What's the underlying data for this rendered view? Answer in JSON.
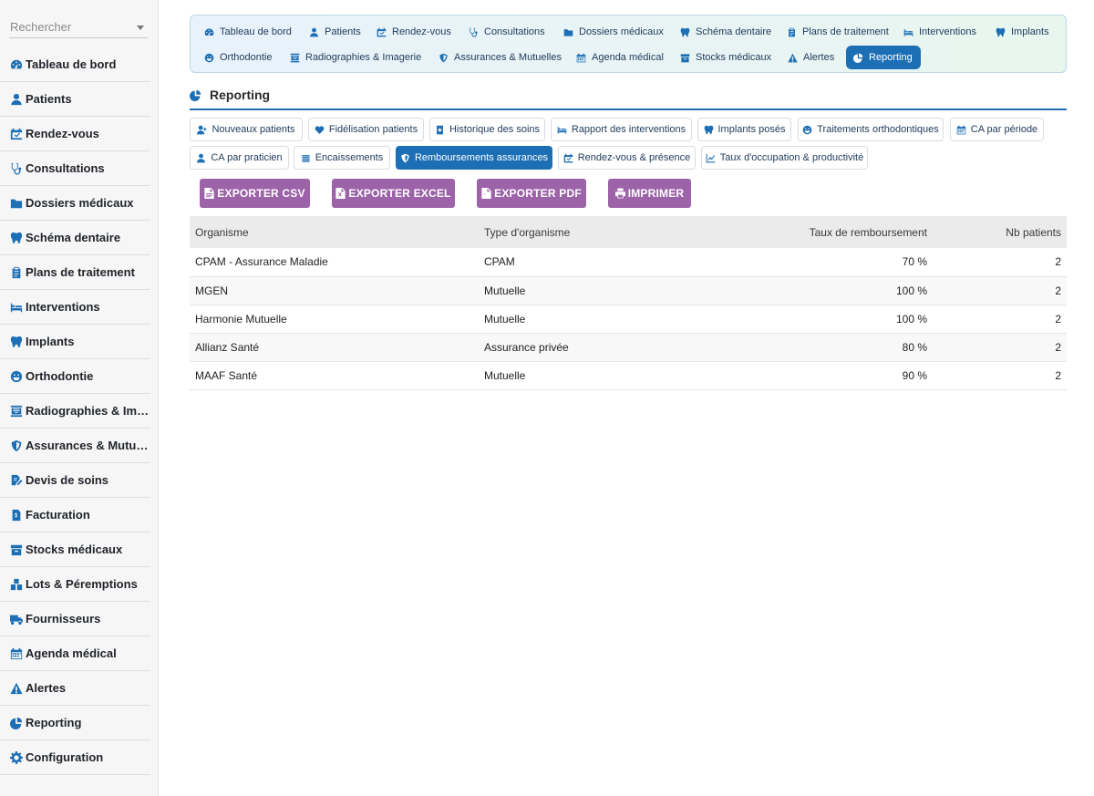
{
  "search": {
    "placeholder": "Rechercher"
  },
  "sidebar": {
    "items": [
      {
        "label": "Tableau de bord",
        "icon": "gauge-icon"
      },
      {
        "label": "Patients",
        "icon": "user-icon"
      },
      {
        "label": "Rendez-vous",
        "icon": "calendar-check-icon"
      },
      {
        "label": "Consultations",
        "icon": "stethoscope-icon"
      },
      {
        "label": "Dossiers médicaux",
        "icon": "folder-icon"
      },
      {
        "label": "Schéma dentaire",
        "icon": "tooth-icon"
      },
      {
        "label": "Plans de traitement",
        "icon": "clipboard-icon"
      },
      {
        "label": "Interventions",
        "icon": "bed-icon"
      },
      {
        "label": "Implants",
        "icon": "tooth-icon"
      },
      {
        "label": "Orthodontie",
        "icon": "smile-icon"
      },
      {
        "label": "Radiographies & Imagerie",
        "icon": "xray-icon"
      },
      {
        "label": "Assurances & Mutuelles",
        "icon": "shield-icon"
      },
      {
        "label": "Devis de soins",
        "icon": "file-signature-icon"
      },
      {
        "label": "Facturation",
        "icon": "invoice-icon"
      },
      {
        "label": "Stocks médicaux",
        "icon": "box-icon"
      },
      {
        "label": "Lots & Péremptions",
        "icon": "boxes-icon"
      },
      {
        "label": "Fournisseurs",
        "icon": "truck-icon"
      },
      {
        "label": "Agenda médical",
        "icon": "calendar-icon"
      },
      {
        "label": "Alertes",
        "icon": "warning-icon"
      },
      {
        "label": "Reporting",
        "icon": "pie-chart-icon"
      },
      {
        "label": "Configuration",
        "icon": "gear-icon"
      }
    ]
  },
  "topnav": {
    "tabs": [
      {
        "label": "Tableau de bord"
      },
      {
        "label": "Patients"
      },
      {
        "label": "Rendez-vous"
      },
      {
        "label": "Consultations"
      },
      {
        "label": "Dossiers médicaux"
      },
      {
        "label": "Schéma dentaire"
      },
      {
        "label": "Plans de traitement"
      },
      {
        "label": "Interventions"
      },
      {
        "label": "Implants"
      },
      {
        "label": "Orthodontie"
      },
      {
        "label": "Radiographies & Imagerie"
      },
      {
        "label": "Assurances & Mutuelles"
      },
      {
        "label": "Agenda médical"
      },
      {
        "label": "Stocks médicaux"
      },
      {
        "label": "Alertes"
      },
      {
        "label": "Reporting"
      }
    ],
    "active": "Reporting"
  },
  "page": {
    "title": "Reporting"
  },
  "reports": {
    "buttons": [
      {
        "label": "Nouveaux patients"
      },
      {
        "label": "Fidélisation patients"
      },
      {
        "label": "Historique des soins"
      },
      {
        "label": "Rapport des interventions"
      },
      {
        "label": "Implants posés"
      },
      {
        "label": "Traitements orthodontiques"
      },
      {
        "label": "CA par période"
      },
      {
        "label": "CA par praticien"
      },
      {
        "label": "Encaissements"
      },
      {
        "label": "Remboursements assurances"
      },
      {
        "label": "Rendez-vous & présence"
      },
      {
        "label": "Taux d'occupation & productivité"
      }
    ],
    "active": "Remboursements assurances"
  },
  "export": {
    "csv": "EXPORTER CSV",
    "excel": "EXPORTER EXCEL",
    "pdf": "EXPORTER PDF",
    "print": "IMPRIMER",
    "color": "#9c63a8"
  },
  "table": {
    "headers": [
      "Organisme",
      "Type d'organisme",
      "Taux de remboursement",
      "Nb patients"
    ],
    "rows": [
      [
        "CPAM - Assurance Maladie",
        "CPAM",
        "70 %",
        "2"
      ],
      [
        "MGEN",
        "Mutuelle",
        "100 %",
        "2"
      ],
      [
        "Harmonie Mutuelle",
        "Mutuelle",
        "100 %",
        "2"
      ],
      [
        "Allianz Santé",
        "Assurance privée",
        "80 %",
        "2"
      ],
      [
        "MAAF Santé",
        "Mutuelle",
        "90 %",
        "2"
      ]
    ]
  },
  "colors": {
    "accent": "#1d6fb5"
  }
}
